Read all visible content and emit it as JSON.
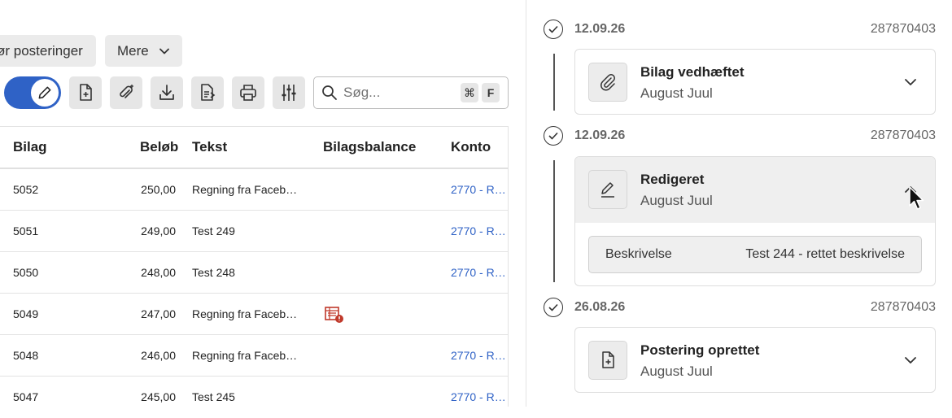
{
  "toolbar": {
    "posteringer_label": "ør posteringer",
    "more_label": "Mere",
    "search_placeholder": "Søg...",
    "shortcut_cmd": "⌘",
    "shortcut_key": "F"
  },
  "table": {
    "headers": {
      "bilag": "Bilag",
      "beloeb": "Beløb",
      "tekst": "Tekst",
      "bilagsbalance": "Bilagsbalance",
      "konto": "Konto"
    },
    "rows": [
      {
        "bilag": "5052",
        "beloeb": "250,00",
        "tekst": "Regning fra Faceb…",
        "konto": "2770 - R…"
      },
      {
        "bilag": "5051",
        "beloeb": "249,00",
        "tekst": "Test 249",
        "konto": "2770 - R…"
      },
      {
        "bilag": "5050",
        "beloeb": "248,00",
        "tekst": "Test 248",
        "konto": "2770 - R…"
      },
      {
        "bilag": "5049",
        "beloeb": "247,00",
        "tekst": "Regning fra Faceb…",
        "konto": ""
      },
      {
        "bilag": "5048",
        "beloeb": "246,00",
        "tekst": "Regning fra Faceb…",
        "konto": "2770 - R…"
      },
      {
        "bilag": "5047",
        "beloeb": "245,00",
        "tekst": "Test 245",
        "konto": "2770 - R…"
      }
    ]
  },
  "history": [
    {
      "date": "12.09.26",
      "ref": "287870403",
      "title": "Bilag vedhæftet",
      "user": "August Juul"
    },
    {
      "date": "12.09.26",
      "ref": "287870403",
      "title": "Redigeret",
      "user": "August Juul",
      "detail": {
        "label": "Beskrivelse",
        "value": "Test 244 - rettet beskrivelse"
      }
    },
    {
      "date": "26.08.26",
      "ref": "287870403",
      "title": "Postering oprettet",
      "user": "August Juul"
    }
  ],
  "colors": {
    "accent": "#2f62c6",
    "warning": "#c0392b"
  }
}
